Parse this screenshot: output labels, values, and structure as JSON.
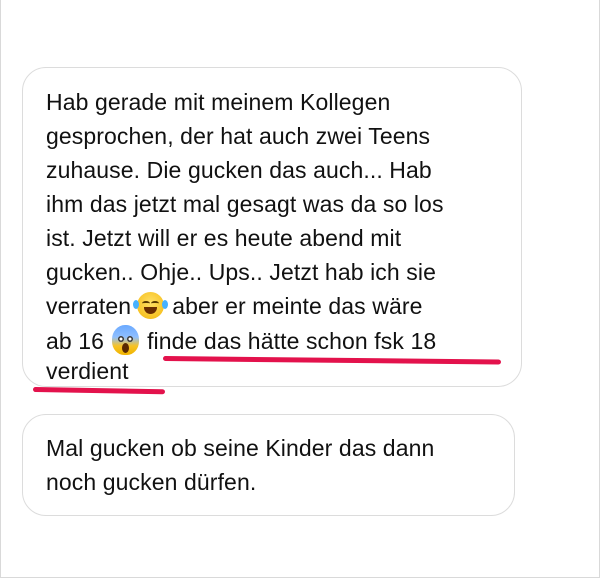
{
  "messages": [
    {
      "lines": [
        "Hab gerade mit meinem Kollegen",
        "gesprochen, der hat auch zwei Teens",
        "zuhause. Die gucken das auch... Hab",
        "ihm das jetzt mal gesagt was da so los",
        "ist. Jetzt will er es heute abend mit",
        "gucken.. Ohje.. Ups.. Jetzt hab ich sie",
        "verraten",
        "aber er meinte das wäre",
        "ab 16",
        "finde das hätte schon fsk 18",
        "verdient"
      ],
      "emojis": [
        "face-with-tears-of-joy",
        "face-screaming-in-fear"
      ],
      "highlight_color": "#e3124c"
    },
    {
      "lines": [
        "Mal gucken ob seine Kinder das dann",
        "noch gucken dürfen."
      ]
    }
  ],
  "colors": {
    "bubble_border": "#dcdcdc",
    "text": "#111111",
    "underline": "#e3124c"
  }
}
